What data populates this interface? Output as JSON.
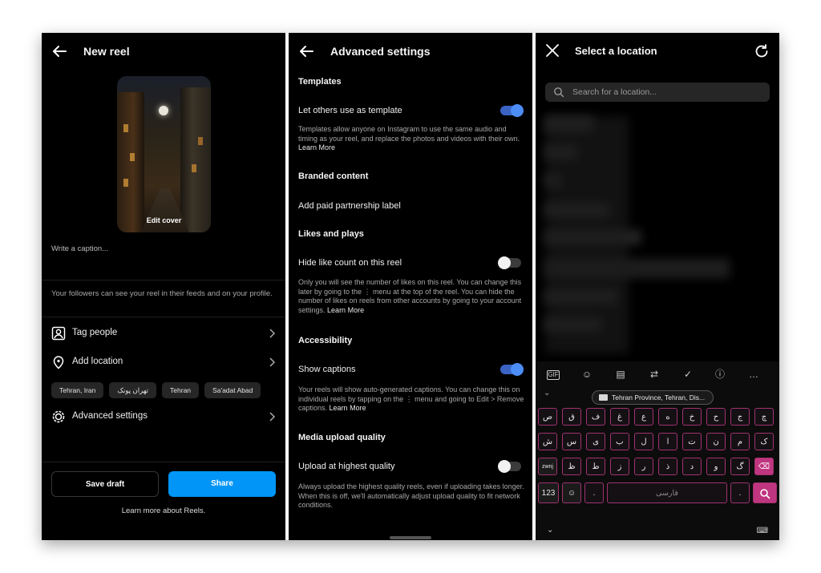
{
  "panel1": {
    "title": "New reel",
    "edit_cover": "Edit cover",
    "caption_placeholder": "Write a caption...",
    "followers_note": "Your followers can see your reel in their feeds and on your profile.",
    "rows": [
      {
        "label": "Tag people",
        "icon": "tag-person-icon"
      },
      {
        "label": "Add location",
        "icon": "location-pin-icon"
      },
      {
        "label": "Advanced settings",
        "icon": "gear-icon"
      }
    ],
    "location_chips": [
      "Tehran, Iran",
      "تهران پونک",
      "Tehran",
      "Sa'adat Abad"
    ],
    "save_draft": "Save draft",
    "share": "Share",
    "learn_more_reels": "Learn more about Reels.",
    "share_color": "#0095f6"
  },
  "panel2": {
    "title": "Advanced settings",
    "templates_header": "Templates",
    "template_option": "Let others use as template",
    "template_desc": "Templates allow anyone on Instagram to use the same audio and timing as your reel, and replace the photos and videos with their own.",
    "learn_more": "Learn More",
    "branded_header": "Branded content",
    "paid_partnership": "Add paid partnership label",
    "likes_header": "Likes and plays",
    "hide_like_option": "Hide like count on this reel",
    "hide_like_desc": "Only you will see the number of likes on this reel. You can change this later by going to the ⋮ menu at the top of the reel. You can hide the number of likes on reels from other accounts by going to your account settings.",
    "accessibility_header": "Accessibility",
    "captions_option": "Show captions",
    "captions_desc": "Your reels will show auto-generated captions. You can change this on individual reels by tapping on the ⋮ menu and going to Edit > Remove captions.",
    "upload_header": "Media upload quality",
    "upload_option": "Upload at highest quality",
    "upload_desc": "Always upload the highest quality reels, even if uploading takes longer. When this is off, we'll automatically adjust upload quality to fit network conditions.",
    "toggles": {
      "template": true,
      "hide_like": false,
      "captions": true,
      "upload": false
    },
    "toggle_on_color": "#4c8df8"
  },
  "panel3": {
    "title": "Select a location",
    "search_placeholder": "Search for a location...",
    "suggestion": "Tehran Province, Tehran, Dis...",
    "keyboard_rows": [
      [
        "ص",
        "ق",
        "ف",
        "غ",
        "ع",
        "ه",
        "خ",
        "ح",
        "ج",
        "چ"
      ],
      [
        "ش",
        "س",
        "ی",
        "ب",
        "ل",
        "ا",
        "ت",
        "ن",
        "م",
        "ک"
      ],
      [
        "zwnj",
        "ظ",
        "ط",
        "ز",
        "ر",
        "ذ",
        "د",
        "و",
        "گ",
        "⌫"
      ]
    ],
    "kbd_numbers": "123",
    "space_label": "فارسی",
    "key_border_color": "#a1326f"
  }
}
